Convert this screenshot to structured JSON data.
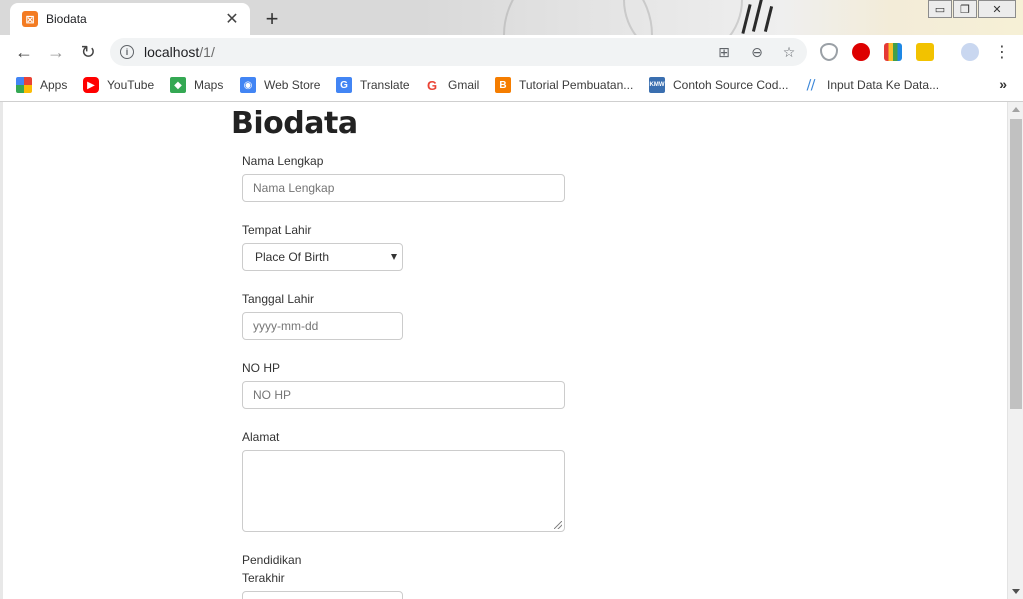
{
  "browser": {
    "tab": {
      "title": "Biodata",
      "favicon": "xampp-icon"
    },
    "address": {
      "host": "localhost",
      "path": "/1/"
    },
    "bookmarks": [
      {
        "label": "Apps",
        "icon": "apps-grid-icon",
        "color": "#e94235"
      },
      {
        "label": "YouTube",
        "icon": "youtube-icon",
        "color": "#ff0000"
      },
      {
        "label": "Maps",
        "icon": "maps-icon",
        "color": "#34a853"
      },
      {
        "label": "Web Store",
        "icon": "webstore-icon",
        "color": "#4285f4"
      },
      {
        "label": "Translate",
        "icon": "translate-icon",
        "color": "#4285f4"
      },
      {
        "label": "Gmail",
        "icon": "google-icon",
        "color": "#ea4335"
      },
      {
        "label": "Tutorial Pembuatan...",
        "icon": "blogger-icon",
        "color": "#f57d00"
      },
      {
        "label": "Contoh Source Cod...",
        "icon": "kmw-icon",
        "color": "#3a6fb0"
      },
      {
        "label": "Input Data Ke Data...",
        "icon": "wix-icon",
        "color": "#3b86d8"
      }
    ],
    "bookmarks_more": "»"
  },
  "page": {
    "title": "Biodata",
    "fields": {
      "nama": {
        "label": "Nama Lengkap",
        "placeholder": "Nama Lengkap"
      },
      "tempat": {
        "label": "Tempat Lahir",
        "selected": "Place Of Birth"
      },
      "tanggal": {
        "label": "Tanggal Lahir",
        "placeholder": "yyyy-mm-dd"
      },
      "hp": {
        "label": "NO HP",
        "placeholder": "NO HP"
      },
      "alamat": {
        "label": "Alamat"
      },
      "pendidikan": {
        "label_line1": "Pendidikan",
        "label_line2": "Terakhir"
      }
    }
  },
  "colors": {
    "tab_favicon": "#f37b22",
    "border": "#cccccc",
    "placeholder": "#999999"
  }
}
